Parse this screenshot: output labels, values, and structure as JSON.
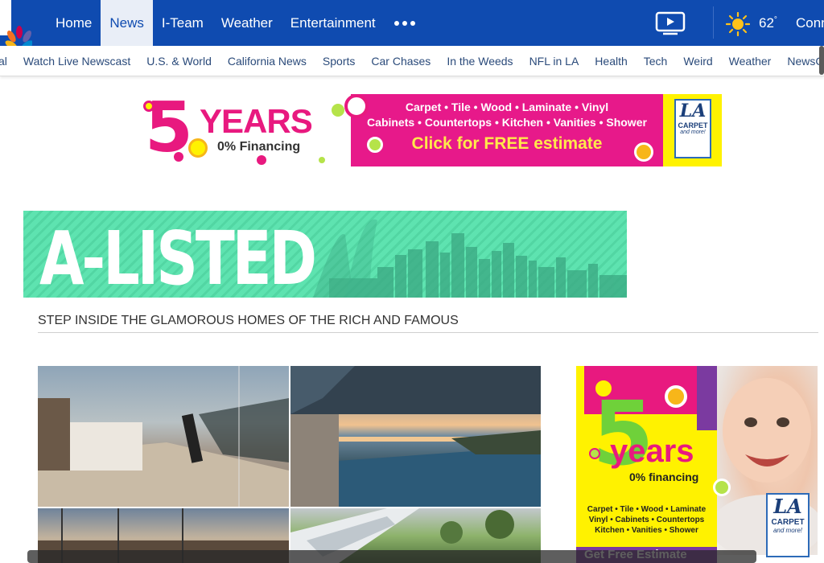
{
  "topnav": {
    "items": [
      "Home",
      "News",
      "I-Team",
      "Weather",
      "Entertainment"
    ],
    "active": "News",
    "temperature": "62",
    "temperature_unit": "°",
    "connect": "Connect"
  },
  "subnav": {
    "items": [
      "al",
      "Watch Live Newscast",
      "U.S. & World",
      "California News",
      "Sports",
      "Car Chases",
      "In the Weeds",
      "NFL in LA",
      "Health",
      "Tech",
      "Weird",
      "Weather",
      "NewsConference"
    ]
  },
  "ad_top": {
    "number": "5",
    "years": "YEARS",
    "financing": "0% Financing",
    "line1": "Carpet • Tile • Wood • Laminate • Vinyl",
    "line2": "Cabinets • Countertops • Kitchen • Vanities • Shower",
    "cta": "Click for FREE estimate",
    "logo_la": "LA",
    "logo_carpet": "CARPET",
    "logo_more": "and more!"
  },
  "section": {
    "title": "A-LISTED",
    "tagline": "STEP INSIDE THE GLAMOROUS HOMES OF THE RICH AND FAMOUS"
  },
  "ad_side": {
    "number": "5",
    "years": "years",
    "financing": "0% financing",
    "prod1": "Carpet • Tile • Wood • Laminate",
    "prod2": "Vinyl • Cabinets • Countertops",
    "prod3": "Kitchen • Vanities • Shower",
    "cta": "Get Free Estimate",
    "logo_la": "LA",
    "logo_carpet": "CARPET",
    "logo_more": "and more!"
  },
  "colors": {
    "brand_blue": "#0f4bb0",
    "magenta": "#e8197f",
    "yellow": "#fff200",
    "mint": "#5ee3b0"
  }
}
